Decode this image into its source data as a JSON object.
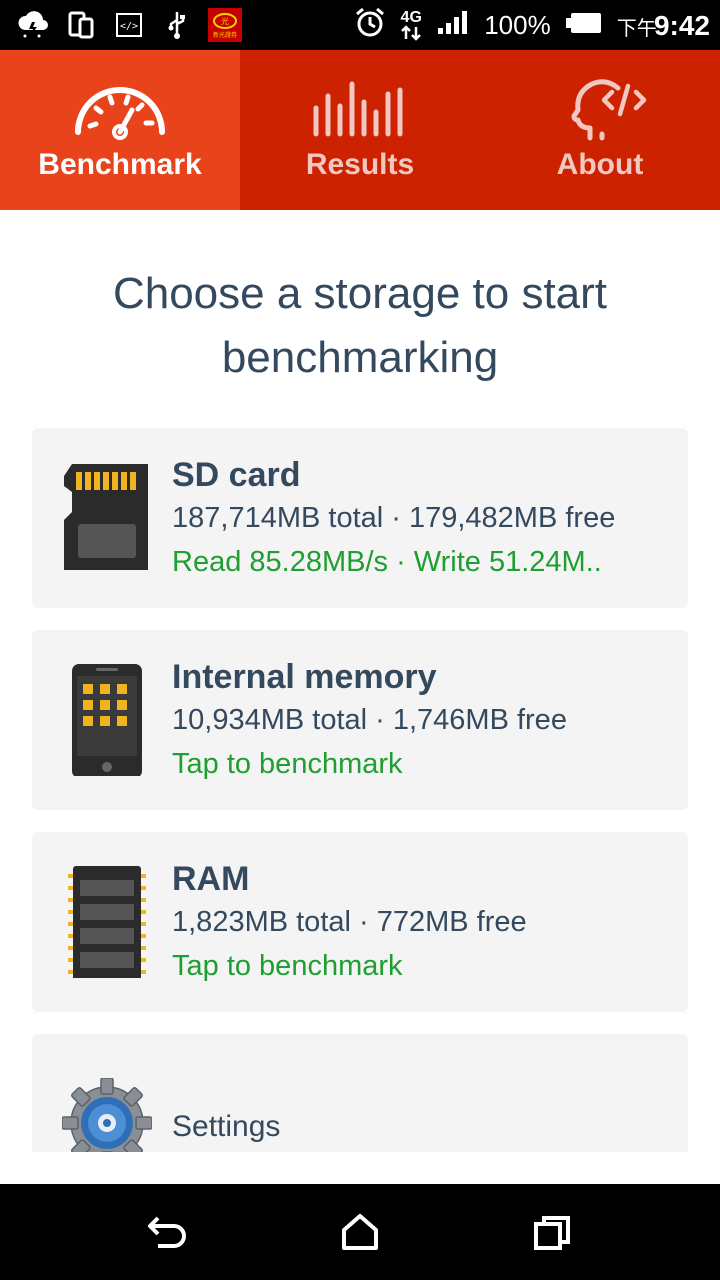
{
  "status_bar": {
    "icons": [
      "cloud-lightning-icon",
      "dual-screen-icon",
      "code-icon",
      "usb-icon",
      "app-badge-icon",
      "alarm-icon",
      "network-4g-icon",
      "signal-icon",
      "battery-icon"
    ],
    "network": "4G",
    "battery": "100%",
    "time_prefix": "下午",
    "time": "9:42",
    "app_badge_text": "新光證券"
  },
  "tabs": [
    {
      "label": "Benchmark",
      "icon": "speedometer-icon",
      "active": true
    },
    {
      "label": "Results",
      "icon": "bars-icon",
      "active": false
    },
    {
      "label": "About",
      "icon": "head-code-icon",
      "active": false
    }
  ],
  "heading": "Choose a storage to start benchmarking",
  "storages": [
    {
      "title": "SD card",
      "subtitle": "187,714MB total · 179,482MB free",
      "status": "Read 85.28MB/s · Write 51.24M..",
      "icon": "sd-card-icon"
    },
    {
      "title": "Internal memory",
      "subtitle": "10,934MB total · 1,746MB free",
      "status": "Tap to benchmark",
      "icon": "phone-icon"
    },
    {
      "title": "RAM",
      "subtitle": "1,823MB total · 772MB free",
      "status": "Tap to benchmark",
      "icon": "ram-chip-icon"
    }
  ],
  "settings": {
    "label": "Settings",
    "icon": "gear-icon"
  },
  "nav": [
    "back-icon",
    "home-icon",
    "recents-icon"
  ],
  "colors": {
    "tab_bar": "#cc2200",
    "tab_active": "#e8431b",
    "text_dark": "#34495e",
    "status_green": "#1f9e31",
    "card_bg": "#f4f4f4"
  }
}
